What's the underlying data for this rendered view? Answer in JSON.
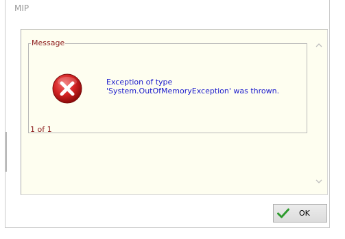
{
  "window": {
    "title": "MIP"
  },
  "message_box": {
    "group_label": "Message",
    "text_line1": "Exception of type",
    "text_line2": "'System.OutOfMemoryException' was thrown.",
    "counter": "1 of 1",
    "icon": "error-x-icon"
  },
  "buttons": {
    "ok_label": "OK",
    "ok_icon": "checkmark-icon"
  },
  "colors": {
    "message_text": "#1c1ccc",
    "label_text": "#8b1a1a",
    "panel_background": "#fefef0",
    "error_red": "#c8141b",
    "check_green": "#2e9b2e"
  }
}
